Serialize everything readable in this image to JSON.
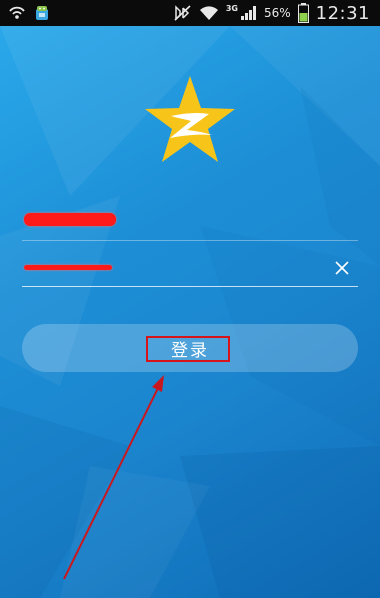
{
  "status_bar": {
    "network_type": "3G",
    "battery_percent": "56%",
    "time": "12:31",
    "icons": [
      "wifi-hotspot-icon",
      "android-app-icon",
      "mute-icon",
      "wifi-icon",
      "signal-icon",
      "battery-icon"
    ]
  },
  "login": {
    "logo_icon": "qzone-star-icon",
    "username": {
      "value": "",
      "redacted": true
    },
    "password": {
      "value": "",
      "redacted": true
    },
    "clear_icon": "close-icon",
    "login_label": "登录"
  },
  "annotation": {
    "highlight_color": "#d8141b",
    "arrow_color": "#c8181f"
  },
  "colors": {
    "bg_top": "#2aa8ea",
    "bg_bottom": "#0f6cb6",
    "logo_yellow": "#f7c41a",
    "redaction": "#ff1a1a"
  }
}
